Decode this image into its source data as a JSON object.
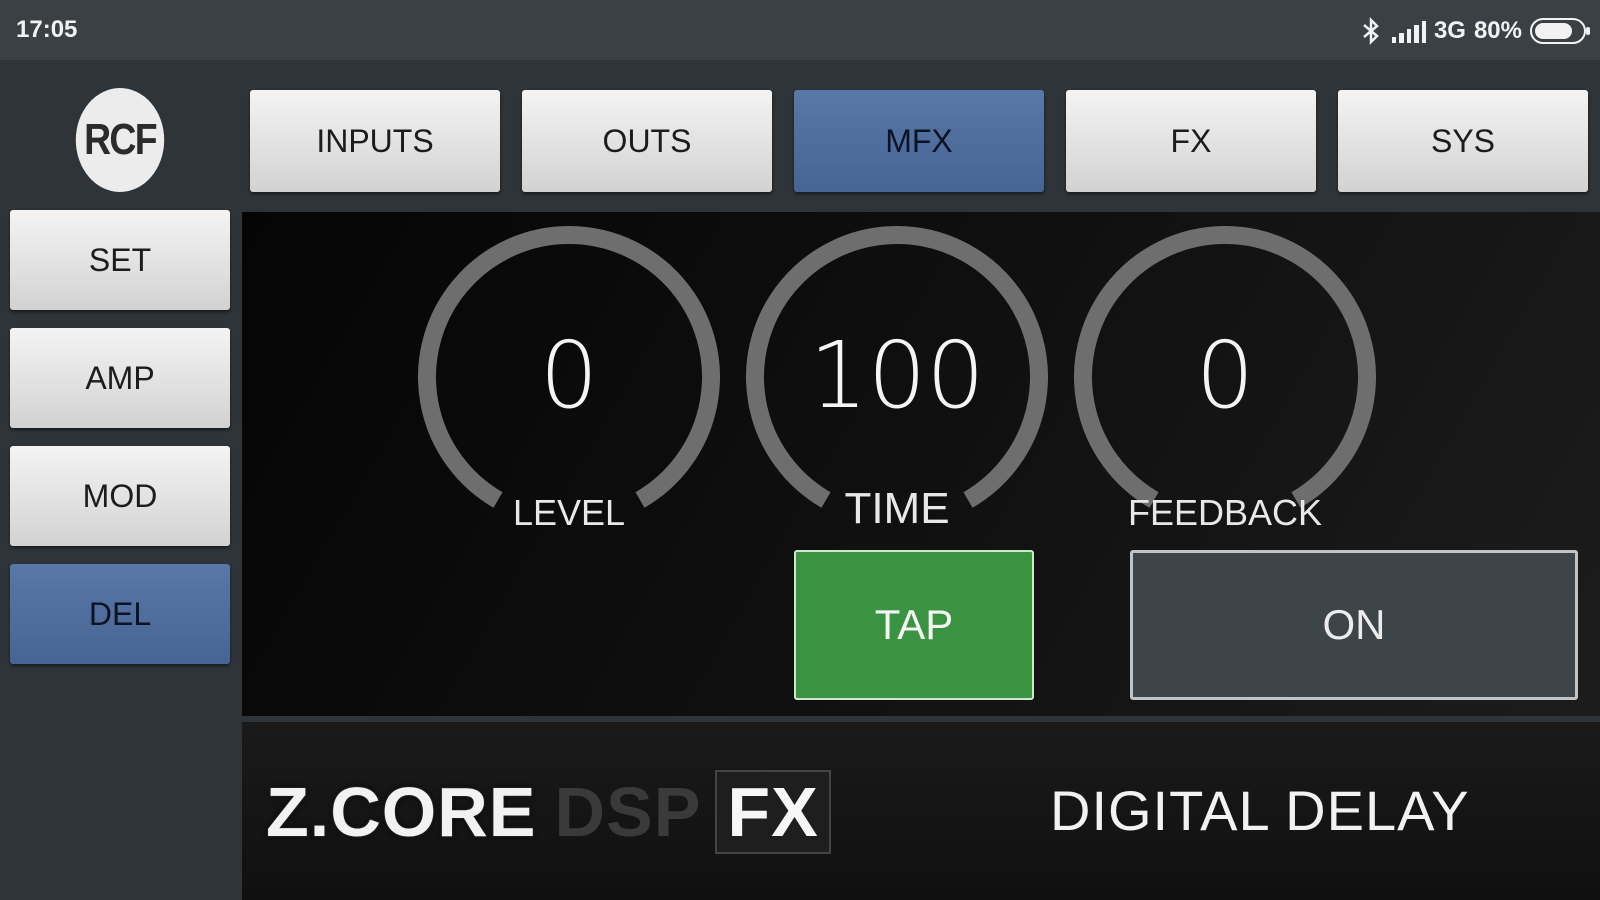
{
  "status_bar": {
    "time": "17:05",
    "network": "3G",
    "battery": "80%",
    "battery_level": 0.8,
    "icons": [
      "bluetooth-icon",
      "signal-icon",
      "battery-icon"
    ]
  },
  "brand_logo": "RCF",
  "tabs": [
    {
      "label": "INPUTS",
      "active": false
    },
    {
      "label": "OUTS",
      "active": false
    },
    {
      "label": "MFX",
      "active": true
    },
    {
      "label": "FX",
      "active": false
    },
    {
      "label": "SYS",
      "active": false
    }
  ],
  "side_menu": [
    {
      "label": "SET",
      "active": false
    },
    {
      "label": "AMP",
      "active": false
    },
    {
      "label": "MOD",
      "active": false
    },
    {
      "label": "DEL",
      "active": true
    }
  ],
  "knobs": [
    {
      "label": "LEVEL",
      "value": "0"
    },
    {
      "label": "TIME",
      "value": "100"
    },
    {
      "label": "FEEDBACK",
      "value": "0"
    }
  ],
  "tap_button": "TAP",
  "on_button": "ON",
  "footer": {
    "brand_part1": "Z.CORE",
    "brand_part2": "DSP",
    "brand_part3": "FX",
    "effect_name": "DIGITAL DELAY"
  },
  "colors": {
    "active_tab": "#5474a4",
    "tap_green": "#3a9340",
    "background": "#2e3438"
  }
}
